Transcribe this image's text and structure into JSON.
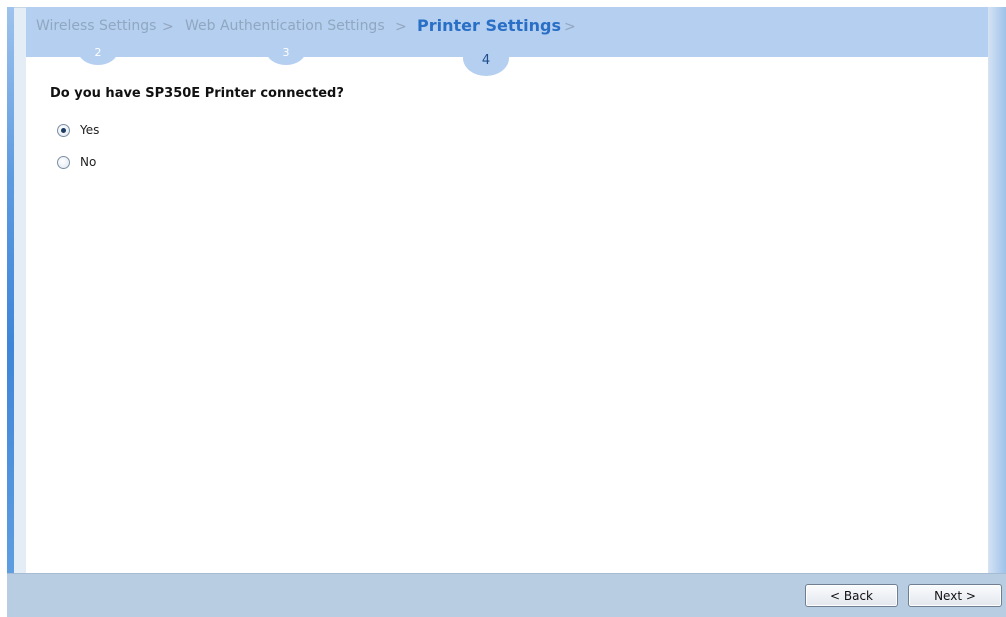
{
  "wizard": {
    "steps": [
      {
        "label": "Wireless Settings",
        "number": "2",
        "state": "done"
      },
      {
        "label": "Web Authentication Settings",
        "number": "3",
        "state": "done"
      },
      {
        "label": "Printer Settings",
        "number": "4",
        "state": "current"
      }
    ],
    "separator": ">"
  },
  "question": "Do you have SP350E Printer connected?",
  "options": [
    {
      "label": "Yes",
      "selected": true
    },
    {
      "label": "No",
      "selected": false
    }
  ],
  "buttons": {
    "back": "< Back",
    "next": "Next >"
  },
  "colors": {
    "header_band": "#b4cff0",
    "active_step": "#2a6fc6",
    "inactive_step": "#8fa7c0",
    "footer": "#b9cde2",
    "left_accent": "#3f86d8"
  }
}
